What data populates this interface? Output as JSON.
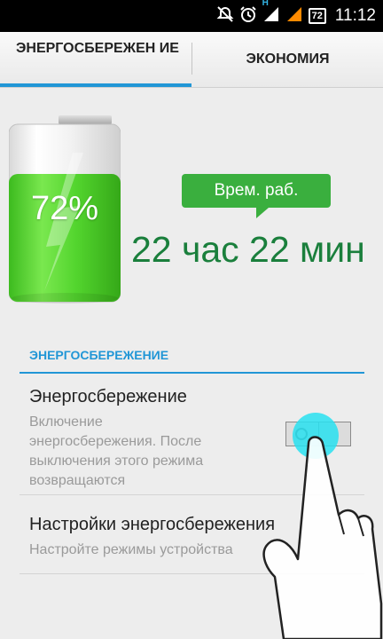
{
  "status_bar": {
    "network_label": "H",
    "battery_level": "72",
    "time": "11:12"
  },
  "tabs": [
    {
      "label": "ЭНЕРГОСБЕРЕЖЕН ИЕ",
      "selected": true
    },
    {
      "label": "ЭКОНОМИЯ",
      "selected": false
    }
  ],
  "battery": {
    "percent_text": "72%",
    "level": 72
  },
  "runtime": {
    "bubble_label": "Врем. раб.",
    "value": "22 час 22 мин"
  },
  "section": {
    "title": "ЭНЕРГОСБЕРЕЖЕНИЕ"
  },
  "preferences": [
    {
      "title": "Энергосбережение",
      "summary": [
        "Включение",
        "энергосбережения. После",
        "выключения этого режима",
        "возвращаются"
      ],
      "switch_on": false
    },
    {
      "title": "Настройки энергосбережения",
      "summary": [
        "Настройте режимы устройства"
      ]
    }
  ],
  "colors": {
    "accent": "#2196d6",
    "battery_green": "#4ccf2e",
    "runtime_text": "#1a7f3c",
    "bubble": "#3aaf3e",
    "touch_indicator": "#28e1f0"
  }
}
